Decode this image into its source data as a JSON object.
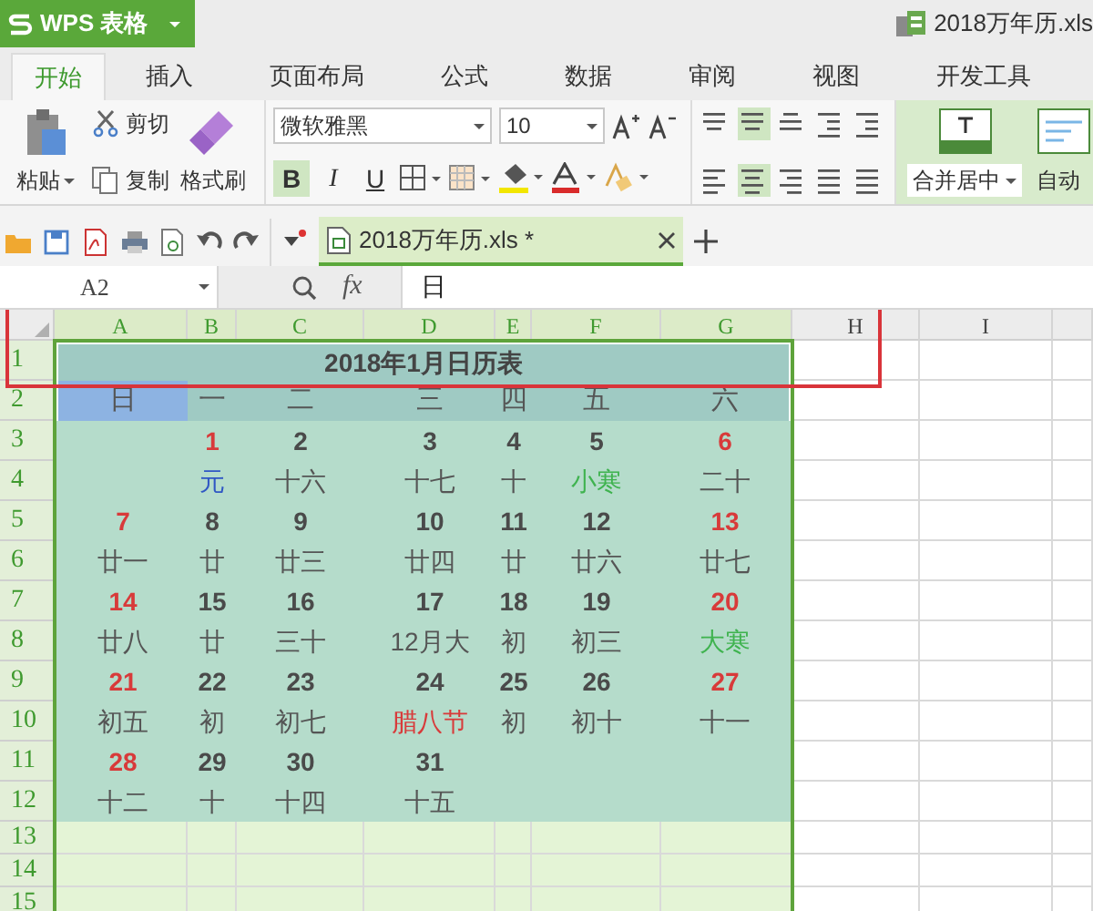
{
  "app": {
    "name": "WPS 表格"
  },
  "window": {
    "title": "2018万年历.xls"
  },
  "ribbon_tabs": [
    {
      "label": "开始",
      "selected": true
    },
    {
      "label": "插入",
      "selected": false
    },
    {
      "label": "页面布局",
      "selected": false
    },
    {
      "label": "公式",
      "selected": false
    },
    {
      "label": "数据",
      "selected": false
    },
    {
      "label": "审阅",
      "selected": false
    },
    {
      "label": "视图",
      "selected": false
    },
    {
      "label": "开发工具",
      "selected": false
    }
  ],
  "ribbon": {
    "paste": "粘贴",
    "cut": "剪切",
    "copy": "复制",
    "format_painter": "格式刷",
    "font_family": "微软雅黑",
    "font_size": "10",
    "styles": [
      {
        "label": "B",
        "on": true
      },
      {
        "label": "I",
        "on": false
      },
      {
        "label": "U",
        "on": false
      }
    ],
    "merge": "合并居中",
    "wrap": "自动"
  },
  "document_tabs": [
    {
      "label": "2018万年历.xls *",
      "selected": true
    }
  ],
  "formula_bar": {
    "cell": "A2",
    "fx": "fx",
    "value": "日"
  },
  "sheet": {
    "columns": [
      {
        "label": "A",
        "selected": true
      },
      {
        "label": "B",
        "selected": true
      },
      {
        "label": "C",
        "selected": true
      },
      {
        "label": "D",
        "selected": true
      },
      {
        "label": "E",
        "selected": true
      },
      {
        "label": "F",
        "selected": true
      },
      {
        "label": "G",
        "selected": true
      },
      {
        "label": "H",
        "selected": false
      },
      {
        "label": "I",
        "selected": false
      }
    ],
    "rows": [
      "1",
      "2",
      "3",
      "4",
      "5",
      "6",
      "7",
      "8",
      "9",
      "10",
      "11",
      "12",
      "13",
      "14",
      "15"
    ],
    "title": "2018年1月日历表",
    "weekdays": [
      {
        "text": "日",
        "selected": true
      },
      {
        "text": "一",
        "selected": false
      },
      {
        "text": "二",
        "selected": false
      },
      {
        "text": "三",
        "selected": false
      },
      {
        "text": "四",
        "selected": false
      },
      {
        "text": "五",
        "selected": false
      },
      {
        "text": "六",
        "selected": false
      }
    ],
    "calendar_rows": [
      {
        "kind": "date",
        "cells": [
          {},
          {
            "text": "1",
            "color": "#d83a3a"
          },
          {
            "text": "2",
            "color": "#4a4a4a"
          },
          {
            "text": "3",
            "color": "#4a4a4a"
          },
          {
            "text": "4",
            "color": "#4a4a4a"
          },
          {
            "text": "5",
            "color": "#4a4a4a"
          },
          {
            "text": "6",
            "color": "#d83a3a"
          }
        ]
      },
      {
        "kind": "lunar",
        "cells": [
          {},
          {
            "text": "元",
            "color": "#2f56c4"
          },
          {
            "text": "十六",
            "color": "#555555"
          },
          {
            "text": "十七",
            "color": "#555555"
          },
          {
            "text": "十",
            "color": "#555555"
          },
          {
            "text": "小寒",
            "color": "#3fb34f"
          },
          {
            "text": "二十",
            "color": "#555555"
          }
        ]
      },
      {
        "kind": "date",
        "cells": [
          {
            "text": "7",
            "color": "#d83a3a"
          },
          {
            "text": "8",
            "color": "#4a4a4a"
          },
          {
            "text": "9",
            "color": "#4a4a4a"
          },
          {
            "text": "10",
            "color": "#4a4a4a"
          },
          {
            "text": "11",
            "color": "#4a4a4a"
          },
          {
            "text": "12",
            "color": "#4a4a4a"
          },
          {
            "text": "13",
            "color": "#d83a3a"
          }
        ]
      },
      {
        "kind": "lunar",
        "cells": [
          {
            "text": "廿一",
            "color": "#555555"
          },
          {
            "text": "廿",
            "color": "#555555"
          },
          {
            "text": "廿三",
            "color": "#555555"
          },
          {
            "text": "廿四",
            "color": "#555555"
          },
          {
            "text": "廿",
            "color": "#555555"
          },
          {
            "text": "廿六",
            "color": "#555555"
          },
          {
            "text": "廿七",
            "color": "#555555"
          }
        ]
      },
      {
        "kind": "date",
        "cells": [
          {
            "text": "14",
            "color": "#d83a3a"
          },
          {
            "text": "15",
            "color": "#4a4a4a"
          },
          {
            "text": "16",
            "color": "#4a4a4a"
          },
          {
            "text": "17",
            "color": "#4a4a4a"
          },
          {
            "text": "18",
            "color": "#4a4a4a"
          },
          {
            "text": "19",
            "color": "#4a4a4a"
          },
          {
            "text": "20",
            "color": "#d83a3a"
          }
        ]
      },
      {
        "kind": "lunar",
        "cells": [
          {
            "text": "廿八",
            "color": "#555555"
          },
          {
            "text": "廿",
            "color": "#555555"
          },
          {
            "text": "三十",
            "color": "#555555"
          },
          {
            "text": "12月大",
            "color": "#555555"
          },
          {
            "text": "初",
            "color": "#555555"
          },
          {
            "text": "初三",
            "color": "#555555"
          },
          {
            "text": "大寒",
            "color": "#3fb34f"
          }
        ]
      },
      {
        "kind": "date",
        "cells": [
          {
            "text": "21",
            "color": "#d83a3a"
          },
          {
            "text": "22",
            "color": "#4a4a4a"
          },
          {
            "text": "23",
            "color": "#4a4a4a"
          },
          {
            "text": "24",
            "color": "#4a4a4a"
          },
          {
            "text": "25",
            "color": "#4a4a4a"
          },
          {
            "text": "26",
            "color": "#4a4a4a"
          },
          {
            "text": "27",
            "color": "#d83a3a"
          }
        ]
      },
      {
        "kind": "lunar",
        "cells": [
          {
            "text": "初五",
            "color": "#555555"
          },
          {
            "text": "初",
            "color": "#555555"
          },
          {
            "text": "初七",
            "color": "#555555"
          },
          {
            "text": "腊八节",
            "color": "#d83a3a"
          },
          {
            "text": "初",
            "color": "#555555"
          },
          {
            "text": "初十",
            "color": "#555555"
          },
          {
            "text": "十一",
            "color": "#555555"
          }
        ]
      },
      {
        "kind": "date",
        "cells": [
          {
            "text": "28",
            "color": "#d83a3a"
          },
          {
            "text": "29",
            "color": "#4a4a4a"
          },
          {
            "text": "30",
            "color": "#4a4a4a"
          },
          {
            "text": "31",
            "color": "#4a4a4a"
          },
          {},
          {},
          {}
        ]
      },
      {
        "kind": "lunar",
        "cells": [
          {
            "text": "十二",
            "color": "#555555"
          },
          {
            "text": "十",
            "color": "#555555"
          },
          {
            "text": "十四",
            "color": "#555555"
          },
          {
            "text": "十五",
            "color": "#555555"
          },
          {},
          {},
          {}
        ]
      }
    ]
  }
}
